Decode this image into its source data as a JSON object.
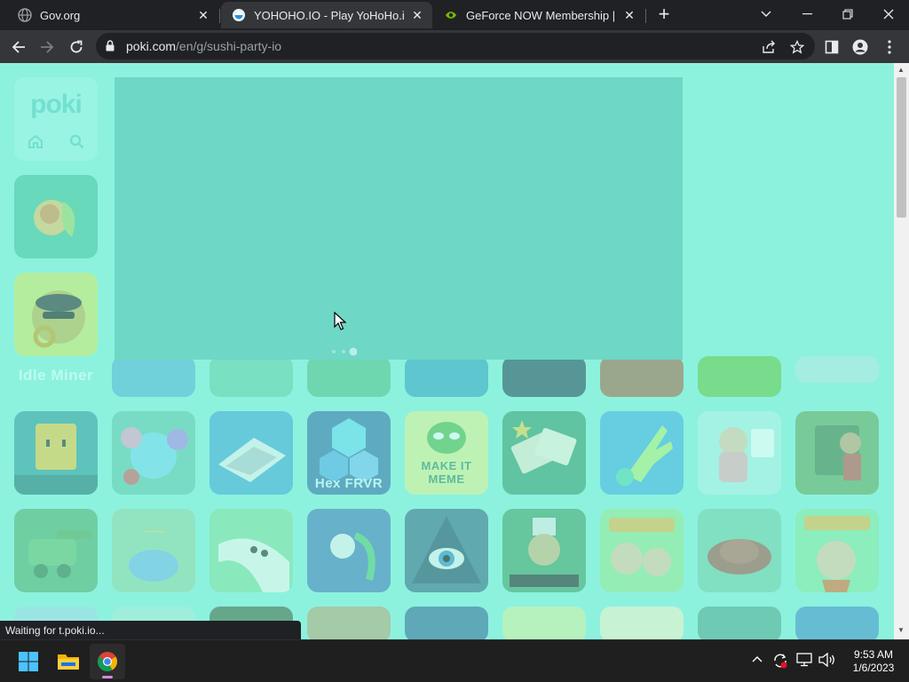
{
  "browser": {
    "tabs": [
      {
        "title": "Gov.org",
        "active": false
      },
      {
        "title": "YOHOHO.IO - Play YoHoHo.io on",
        "active": true
      },
      {
        "title": "GeForce NOW Membership | NVI",
        "active": false
      }
    ],
    "new_tab_label": "+",
    "url_host": "poki.com",
    "url_path": "/en/g/sushi-party-io"
  },
  "page": {
    "logo_text": "poki",
    "tiles": [
      {
        "label": "Idle Miner",
        "color": "#3aa8a0"
      },
      {
        "label": "Hex FRVR",
        "color": "#3a88b8"
      },
      {
        "label": "MAKE IT MEME",
        "color": "#5bb874"
      }
    ],
    "loader_color": "#6ed7c6",
    "overlay_color": "#8cf0dc"
  },
  "status_text": "Waiting for t.poki.io...",
  "taskbar": {
    "time": "9:53 AM",
    "date": "1/6/2023"
  }
}
